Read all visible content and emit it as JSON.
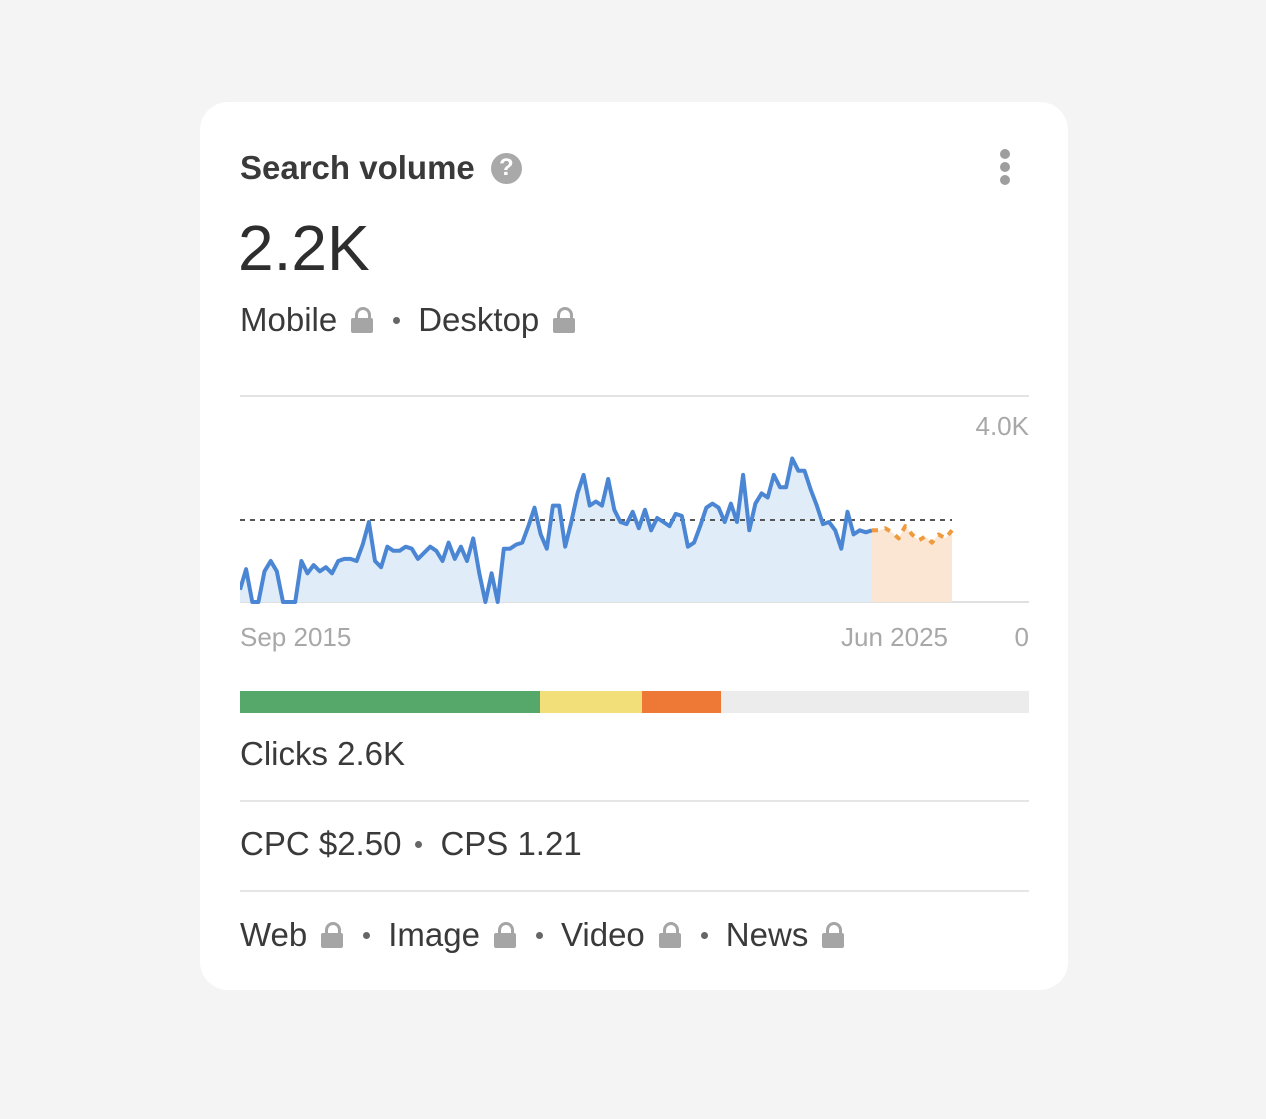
{
  "widget": {
    "title": "Search volume",
    "help_icon_glyph": "?",
    "volume": "2.2K",
    "devices": [
      {
        "label": "Mobile",
        "locked": true
      },
      {
        "label": "Desktop",
        "locked": true
      }
    ]
  },
  "chart_data": {
    "type": "area",
    "x_start_label": "Sep 2015",
    "x_end_label": "Jun 2025",
    "y_top_label": "4.0K",
    "y_bottom_label": "0",
    "ylim": [
      0,
      4000
    ],
    "average": 2000,
    "colors": {
      "history": "#4a86d4",
      "forecast": "#ef9a3c",
      "average": "#555555"
    },
    "history": [
      300,
      800,
      0,
      0,
      750,
      1000,
      750,
      0,
      0,
      0,
      1000,
      700,
      900,
      750,
      850,
      700,
      1000,
      1050,
      1050,
      1000,
      1400,
      1950,
      1000,
      850,
      1350,
      1250,
      1250,
      1350,
      1300,
      1050,
      1200,
      1350,
      1250,
      1000,
      1450,
      1050,
      1350,
      1000,
      1550,
      700,
      0,
      700,
      0,
      1300,
      1300,
      1400,
      1450,
      1850,
      2300,
      1650,
      1300,
      2350,
      2350,
      1350,
      1950,
      2650,
      3100,
      2350,
      2450,
      2350,
      3000,
      2250,
      1950,
      1900,
      2200,
      1800,
      2250,
      1750,
      2050,
      1950,
      1850,
      2150,
      2100,
      1350,
      1450,
      1850,
      2300,
      2400,
      2300,
      1950,
      2400,
      1950,
      3100,
      1750,
      2400,
      2650,
      2550,
      3100,
      2800,
      2800,
      3500,
      3200,
      3200,
      2750,
      2350,
      1900,
      1950,
      1750,
      1300,
      2200,
      1650,
      1750,
      1700,
      1750
    ],
    "forecast": [
      1750,
      1800,
      1700,
      1550,
      1850,
      1650,
      1500,
      1600,
      1450,
      1650,
      1550,
      1750
    ]
  },
  "difficulty_bar": {
    "segments": [
      {
        "fraction": 0.38,
        "color": "#55a76a"
      },
      {
        "fraction": 0.13,
        "color": "#f3df79"
      },
      {
        "fraction": 0.1,
        "color": "#ee7937"
      }
    ],
    "track_color": "#ececec"
  },
  "metrics": {
    "clicks": "Clicks 2.6K",
    "cpc": "CPC $2.50",
    "cps": "CPS 1.21"
  },
  "search_types": [
    {
      "label": "Web",
      "locked": true
    },
    {
      "label": "Image",
      "locked": true
    },
    {
      "label": "Video",
      "locked": true
    },
    {
      "label": "News",
      "locked": true
    }
  ]
}
